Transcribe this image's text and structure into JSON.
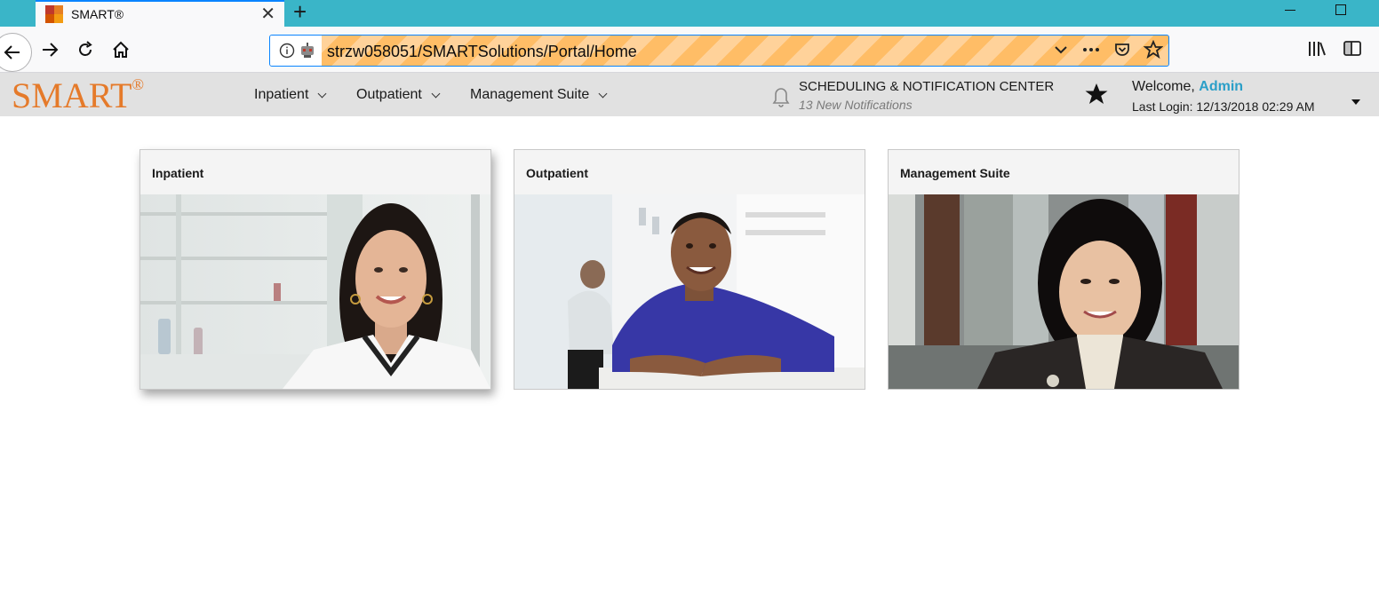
{
  "browser": {
    "tab_title": "SMART®",
    "url": "strzw058051/SMARTSolutions/Portal/Home"
  },
  "header": {
    "logo_text": "SMART",
    "logo_mark": "®",
    "menu": [
      {
        "label": "Inpatient"
      },
      {
        "label": "Outpatient"
      },
      {
        "label": "Management Suite"
      }
    ],
    "notifications": {
      "title": "SCHEDULING & NOTIFICATION CENTER",
      "subtitle": "13 New Notifications"
    },
    "user": {
      "welcome_prefix": "Welcome,",
      "name": "Admin",
      "last_login": "Last Login: 12/13/2018 02:29 AM"
    }
  },
  "tiles": [
    {
      "title": "Inpatient",
      "image": "woman-lab-coat-photo"
    },
    {
      "title": "Outpatient",
      "image": "man-pharmacy-photo"
    },
    {
      "title": "Management Suite",
      "image": "woman-office-photo"
    }
  ],
  "colors": {
    "brand_orange": "#e57a2a",
    "admin_link": "#2b9fc8",
    "tabbar": "#3ab5c8",
    "appbar": "#e1e1e1"
  }
}
